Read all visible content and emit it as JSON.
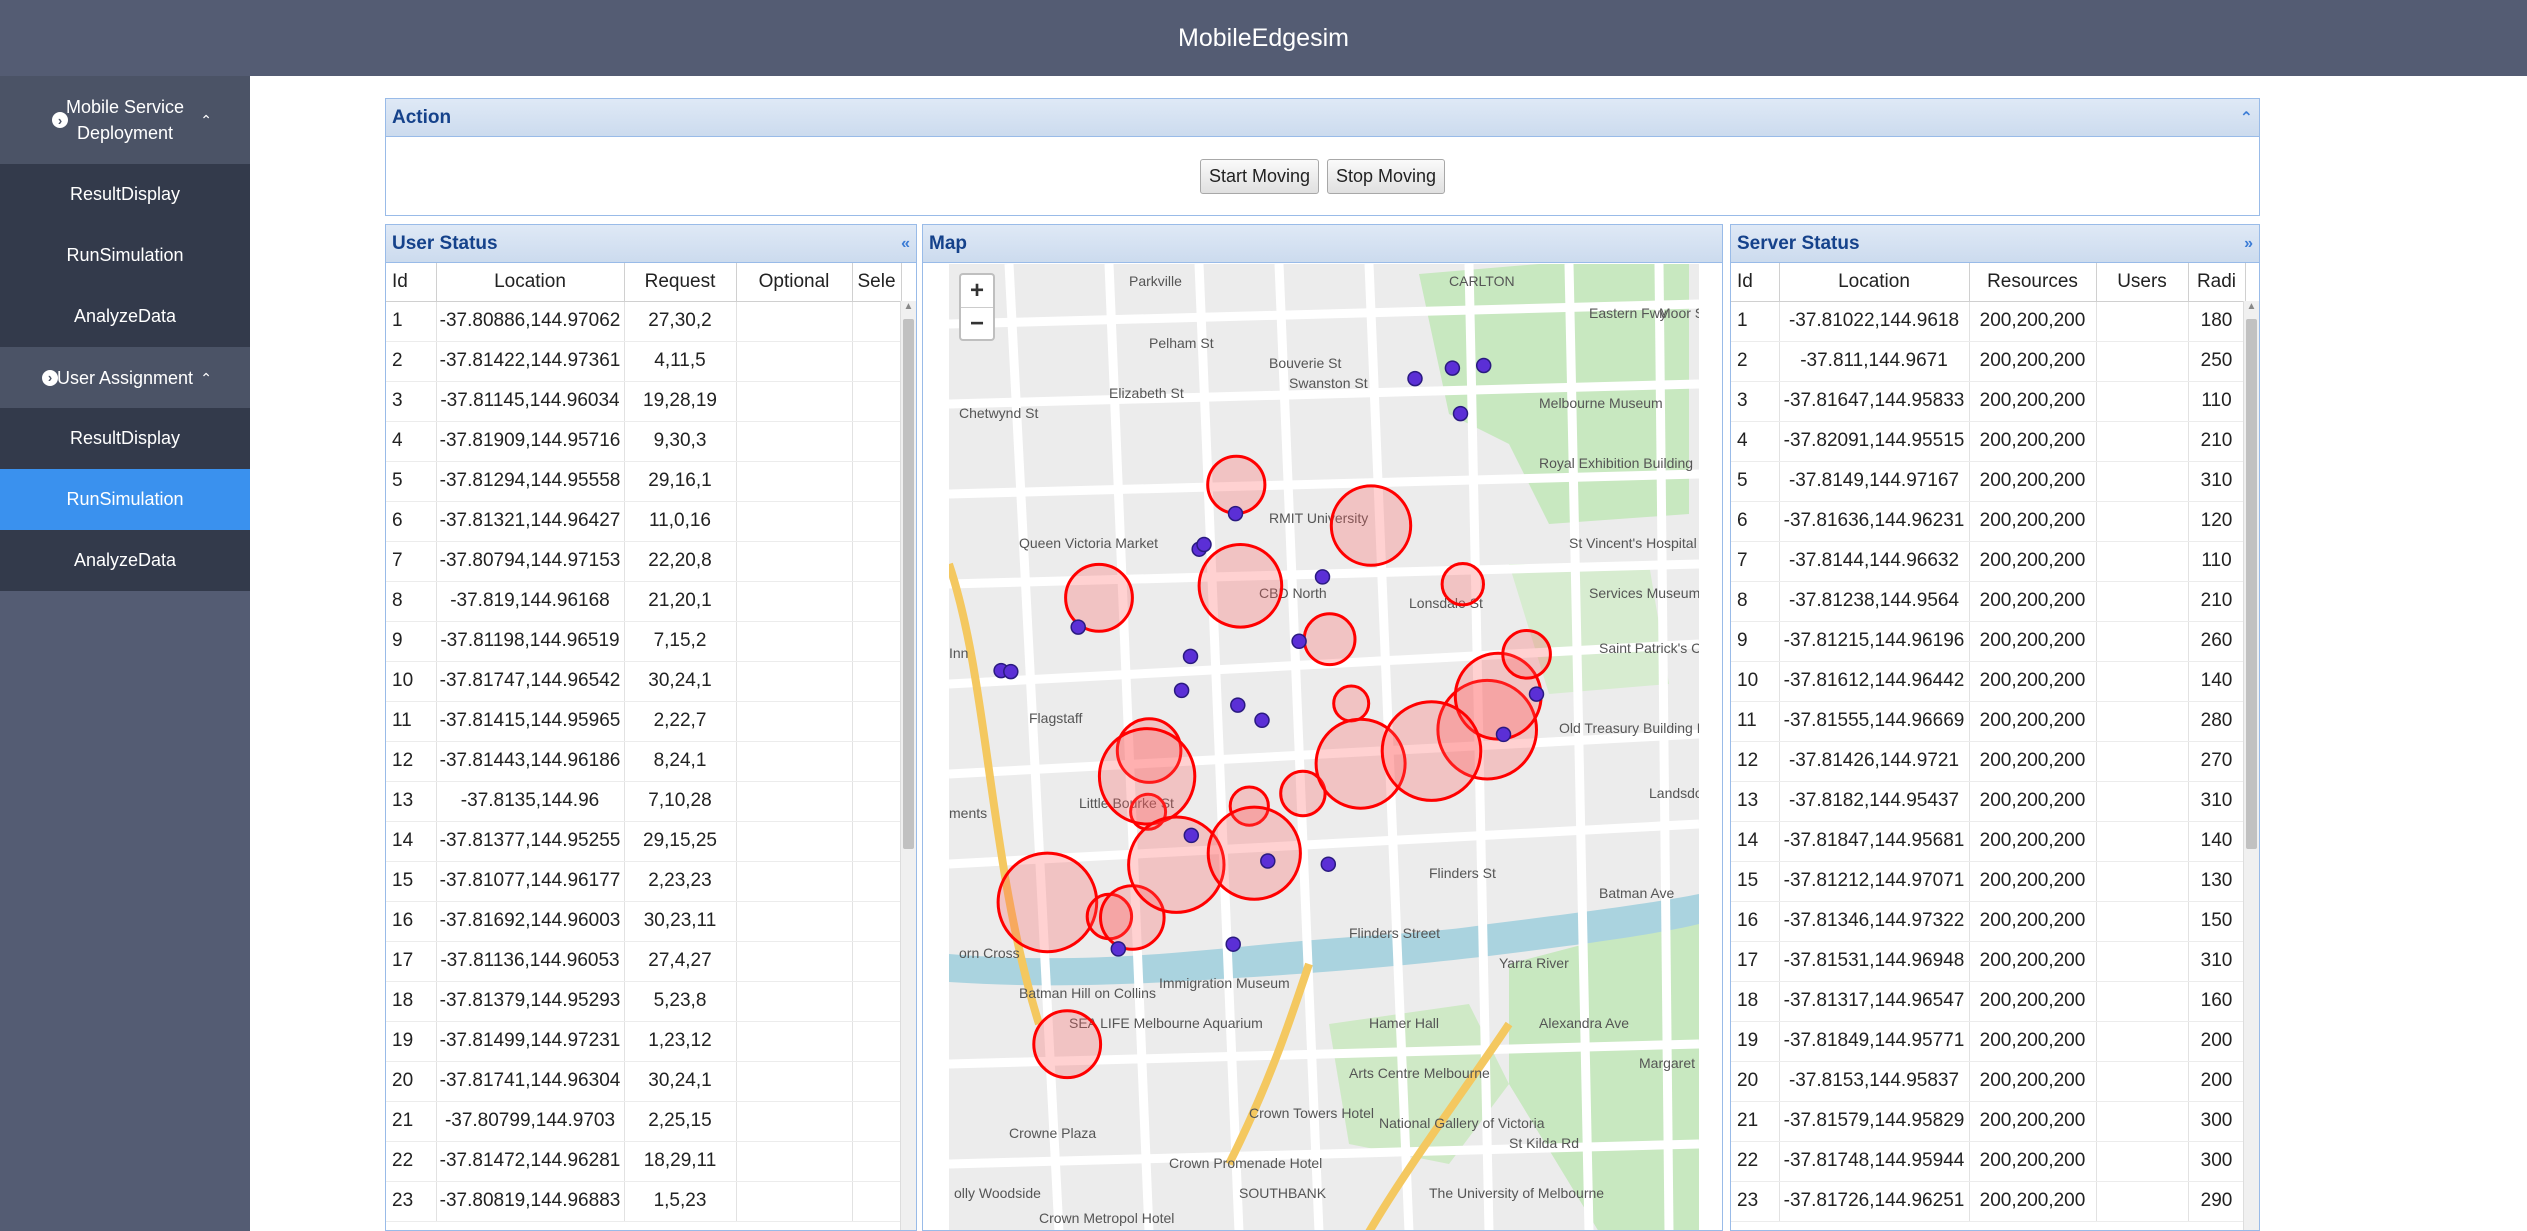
{
  "app": {
    "title": "MobileEdgesim"
  },
  "sidebar": {
    "groups": [
      {
        "label": "Mobile Service Deployment",
        "items": [
          "ResultDisplay",
          "RunSimulation",
          "AnalyzeData"
        ]
      },
      {
        "label": "User Assignment",
        "items": [
          "ResultDisplay",
          "RunSimulation",
          "AnalyzeData"
        ]
      }
    ],
    "active": "User Assignment / RunSimulation"
  },
  "action": {
    "title": "Action",
    "start_label": "Start Moving",
    "stop_label": "Stop Moving"
  },
  "users": {
    "title": "User Status",
    "columns": [
      "Id",
      "Location",
      "Request",
      "Optional",
      "Sele"
    ],
    "rows": [
      [
        "1",
        "-37.80886,144.97062",
        "27,30,2",
        "",
        ""
      ],
      [
        "2",
        "-37.81422,144.97361",
        "4,11,5",
        "",
        ""
      ],
      [
        "3",
        "-37.81145,144.96034",
        "19,28,19",
        "",
        ""
      ],
      [
        "4",
        "-37.81909,144.95716",
        "9,30,3",
        "",
        ""
      ],
      [
        "5",
        "-37.81294,144.95558",
        "29,16,1",
        "",
        ""
      ],
      [
        "6",
        "-37.81321,144.96427",
        "11,0,16",
        "",
        ""
      ],
      [
        "7",
        "-37.80794,144.97153",
        "22,20,8",
        "",
        ""
      ],
      [
        "8",
        "-37.819,144.96168",
        "21,20,1",
        "",
        ""
      ],
      [
        "9",
        "-37.81198,144.96519",
        "7,15,2",
        "",
        ""
      ],
      [
        "10",
        "-37.81747,144.96542",
        "30,24,1",
        "",
        ""
      ],
      [
        "11",
        "-37.81415,144.95965",
        "2,22,7",
        "",
        ""
      ],
      [
        "12",
        "-37.81443,144.96186",
        "8,24,1",
        "",
        ""
      ],
      [
        "13",
        "-37.8135,144.96",
        "7,10,28",
        "",
        ""
      ],
      [
        "14",
        "-37.81377,144.95255",
        "29,15,25",
        "",
        ""
      ],
      [
        "15",
        "-37.81077,144.96177",
        "2,23,23",
        "",
        ""
      ],
      [
        "16",
        "-37.81692,144.96003",
        "30,23,11",
        "",
        ""
      ],
      [
        "17",
        "-37.81136,144.96053",
        "27,4,27",
        "",
        ""
      ],
      [
        "18",
        "-37.81379,144.95293",
        "5,23,8",
        "",
        ""
      ],
      [
        "19",
        "-37.81499,144.97231",
        "1,23,12",
        "",
        ""
      ],
      [
        "20",
        "-37.81741,144.96304",
        "30,24,1",
        "",
        ""
      ],
      [
        "21",
        "-37.80799,144.9703",
        "2,25,15",
        "",
        ""
      ],
      [
        "22",
        "-37.81472,144.96281",
        "18,29,11",
        "",
        ""
      ],
      [
        "23",
        "-37.80819,144.96883",
        "1,5,23",
        "",
        ""
      ]
    ]
  },
  "map": {
    "title": "Map",
    "zoom_in": "+",
    "zoom_out": "−",
    "labels": [
      "CARLTON",
      "Parkville",
      "Pelham St",
      "Elizabeth St",
      "Bouverie St",
      "Swanston St",
      "Moor St",
      "Chetwynd St",
      "Melbourne Museum",
      "Royal Exhibition Building",
      "RMIT University",
      "Queen Victoria Market",
      "St Vincent's Hospital",
      "CBD North",
      "Services Museum",
      "Saint Patrick's Cathedral",
      "Flagstaff",
      "Old Treasury Building Museum",
      "Lonsdale St",
      "Little Bourke St",
      "Flinders St",
      "Flinders Street",
      "Yarra River",
      "Alexandra Ave",
      "Hamer Hall",
      "Arts Centre Melbourne",
      "Crown Towers Hotel",
      "National Gallery of Victoria",
      "Crowne Plaza",
      "Crown Promenade Hotel",
      "SOUTHBANK",
      "The University of Melbourne",
      "St Kilda Rd",
      "Crown Metropol Hotel",
      "Margaret Gr",
      "Eastern Fwy",
      "Batman Ave",
      "Immigration Museum",
      "Batman Hill on Collins",
      "SEA LIFE Melbourne Aquarium",
      "olly Woodside",
      "ments",
      "orn Cross",
      "Inn",
      "Landsdowne St"
    ]
  },
  "servers": {
    "title": "Server Status",
    "columns": [
      "Id",
      "Location",
      "Resources",
      "Users",
      "Radi"
    ],
    "rows": [
      [
        "1",
        "-37.81022,144.9618",
        "200,200,200",
        "",
        "180"
      ],
      [
        "2",
        "-37.811,144.9671",
        "200,200,200",
        "",
        "250"
      ],
      [
        "3",
        "-37.81647,144.95833",
        "200,200,200",
        "",
        "110"
      ],
      [
        "4",
        "-37.82091,144.95515",
        "200,200,200",
        "",
        "210"
      ],
      [
        "5",
        "-37.8149,144.97167",
        "200,200,200",
        "",
        "310"
      ],
      [
        "6",
        "-37.81636,144.96231",
        "200,200,200",
        "",
        "120"
      ],
      [
        "7",
        "-37.8144,144.96632",
        "200,200,200",
        "",
        "110"
      ],
      [
        "8",
        "-37.81238,144.9564",
        "200,200,200",
        "",
        "210"
      ],
      [
        "9",
        "-37.81215,144.96196",
        "200,200,200",
        "",
        "260"
      ],
      [
        "10",
        "-37.81612,144.96442",
        "200,200,200",
        "",
        "140"
      ],
      [
        "11",
        "-37.81555,144.96669",
        "200,200,200",
        "",
        "280"
      ],
      [
        "12",
        "-37.81426,144.9721",
        "200,200,200",
        "",
        "270"
      ],
      [
        "13",
        "-37.8182,144.95437",
        "200,200,200",
        "",
        "310"
      ],
      [
        "14",
        "-37.81847,144.95681",
        "200,200,200",
        "",
        "140"
      ],
      [
        "15",
        "-37.81212,144.97071",
        "200,200,200",
        "",
        "130"
      ],
      [
        "16",
        "-37.81346,144.97322",
        "200,200,200",
        "",
        "150"
      ],
      [
        "17",
        "-37.81531,144.96948",
        "200,200,200",
        "",
        "310"
      ],
      [
        "18",
        "-37.81317,144.96547",
        "200,200,200",
        "",
        "160"
      ],
      [
        "19",
        "-37.81849,144.95771",
        "200,200,200",
        "",
        "200"
      ],
      [
        "20",
        "-37.8153,144.95837",
        "200,200,200",
        "",
        "200"
      ],
      [
        "21",
        "-37.81579,144.95829",
        "200,200,200",
        "",
        "300"
      ],
      [
        "22",
        "-37.81748,144.95944",
        "200,200,200",
        "",
        "300"
      ],
      [
        "23",
        "-37.81726,144.96251",
        "200,200,200",
        "",
        "290"
      ]
    ]
  },
  "colors": {
    "header": "#545c73",
    "active": "#3a91ee",
    "coverage": "#ff0000",
    "user_dot": "#5b2fd6",
    "map_bg": "#ececec"
  }
}
